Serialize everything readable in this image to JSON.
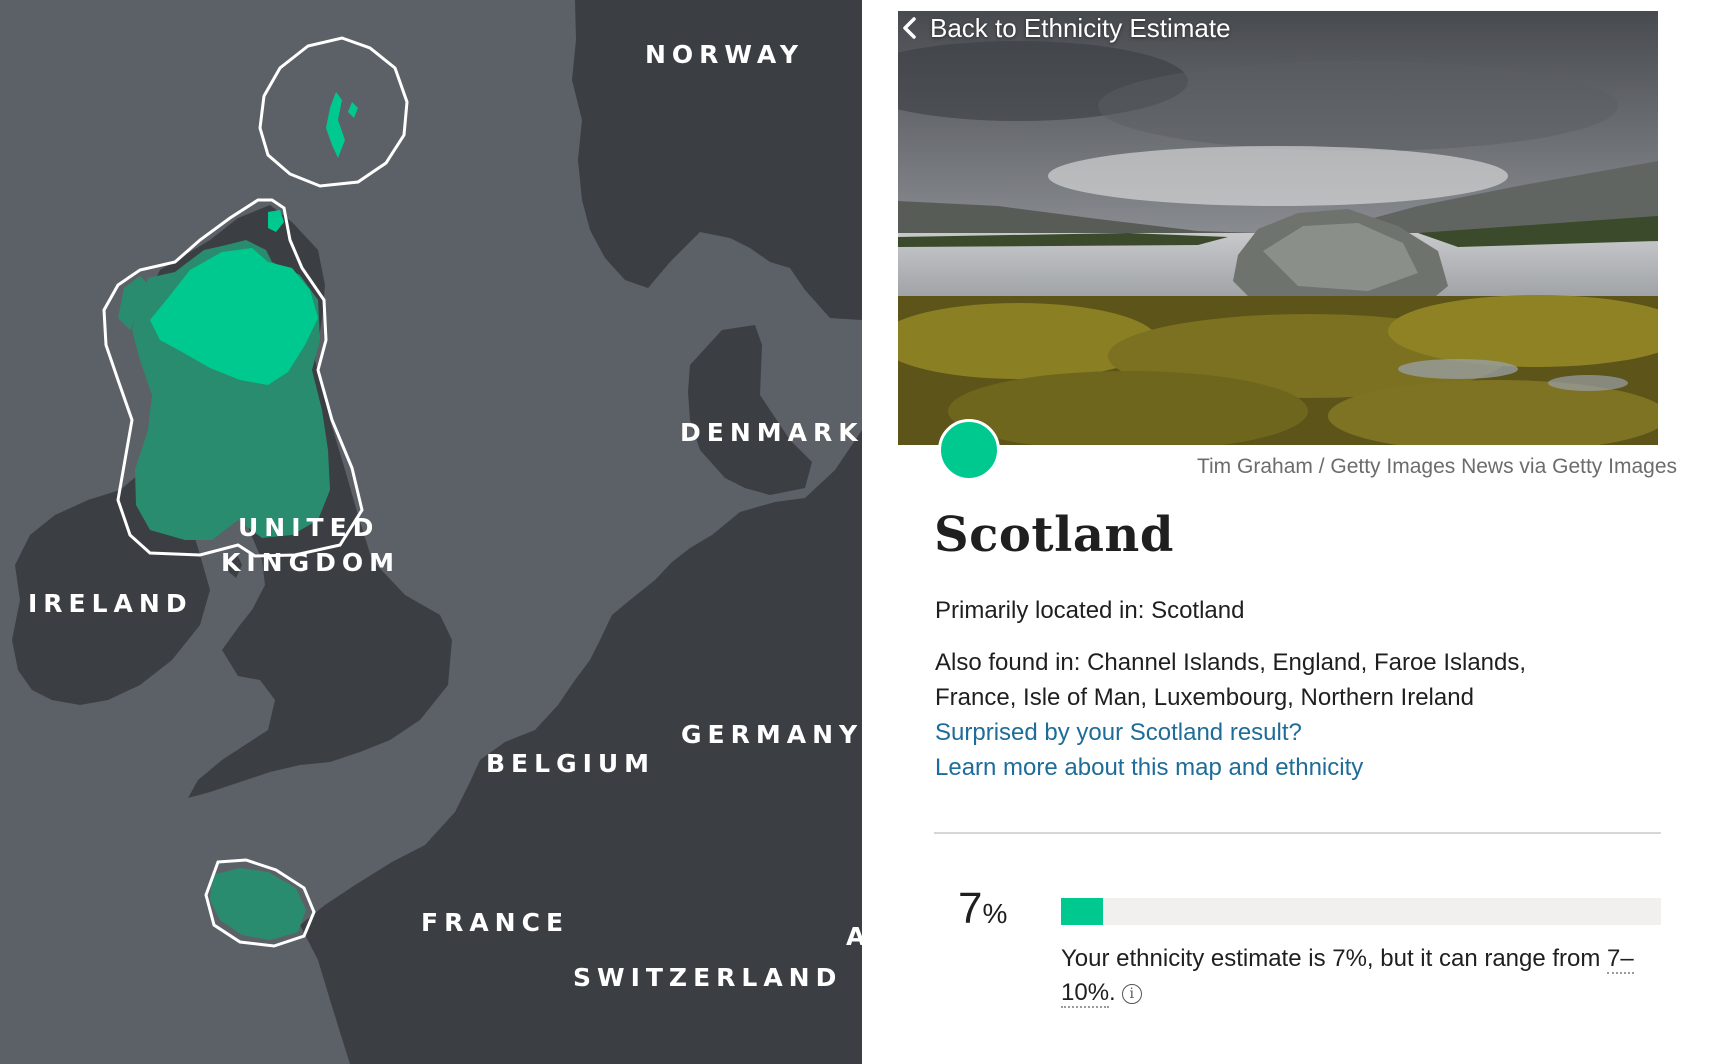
{
  "map": {
    "labels": {
      "norway": "NORWAY",
      "denmark": "DENMARK",
      "united": "UNITED",
      "kingdom": "KINGDOM",
      "ireland": "IRELAND",
      "germany": "GERMANY",
      "belgium": "BELGIUM",
      "france": "FRANCE",
      "switzerland": "SWITZERLAND",
      "austria_partial": "A"
    },
    "colors": {
      "sea": "#5c6167",
      "land": "#3b3e43",
      "region_primary": "#00c98f",
      "region_secondary": "#2a8c6f",
      "outline": "#ffffff"
    }
  },
  "panel": {
    "back_label": "Back to Ethnicity Estimate",
    "photo_credit": "Tim Graham / Getty Images News via Getty Images",
    "region_name": "Scotland",
    "primary_location": "Primarily located in: Scotland",
    "also_found_line1": "Also found in: Channel Islands, England, Faroe Islands,",
    "also_found_line2": "France, Isle of Man, Luxembourg, Northern Ireland",
    "link_surprised": "Surprised by your Scotland result?",
    "link_learn_more": "Learn more about this map and ethnicity",
    "estimate": {
      "percent_number": "7",
      "percent_symbol": "%",
      "fraction": 0.07,
      "text_part1": "Your ethnicity estimate is 7%, but it can range from ",
      "range": "7–10%",
      "text_end": ".",
      "info_glyph": "i"
    },
    "colors": {
      "accent": "#00c98f",
      "link": "#1e6c98"
    }
  }
}
